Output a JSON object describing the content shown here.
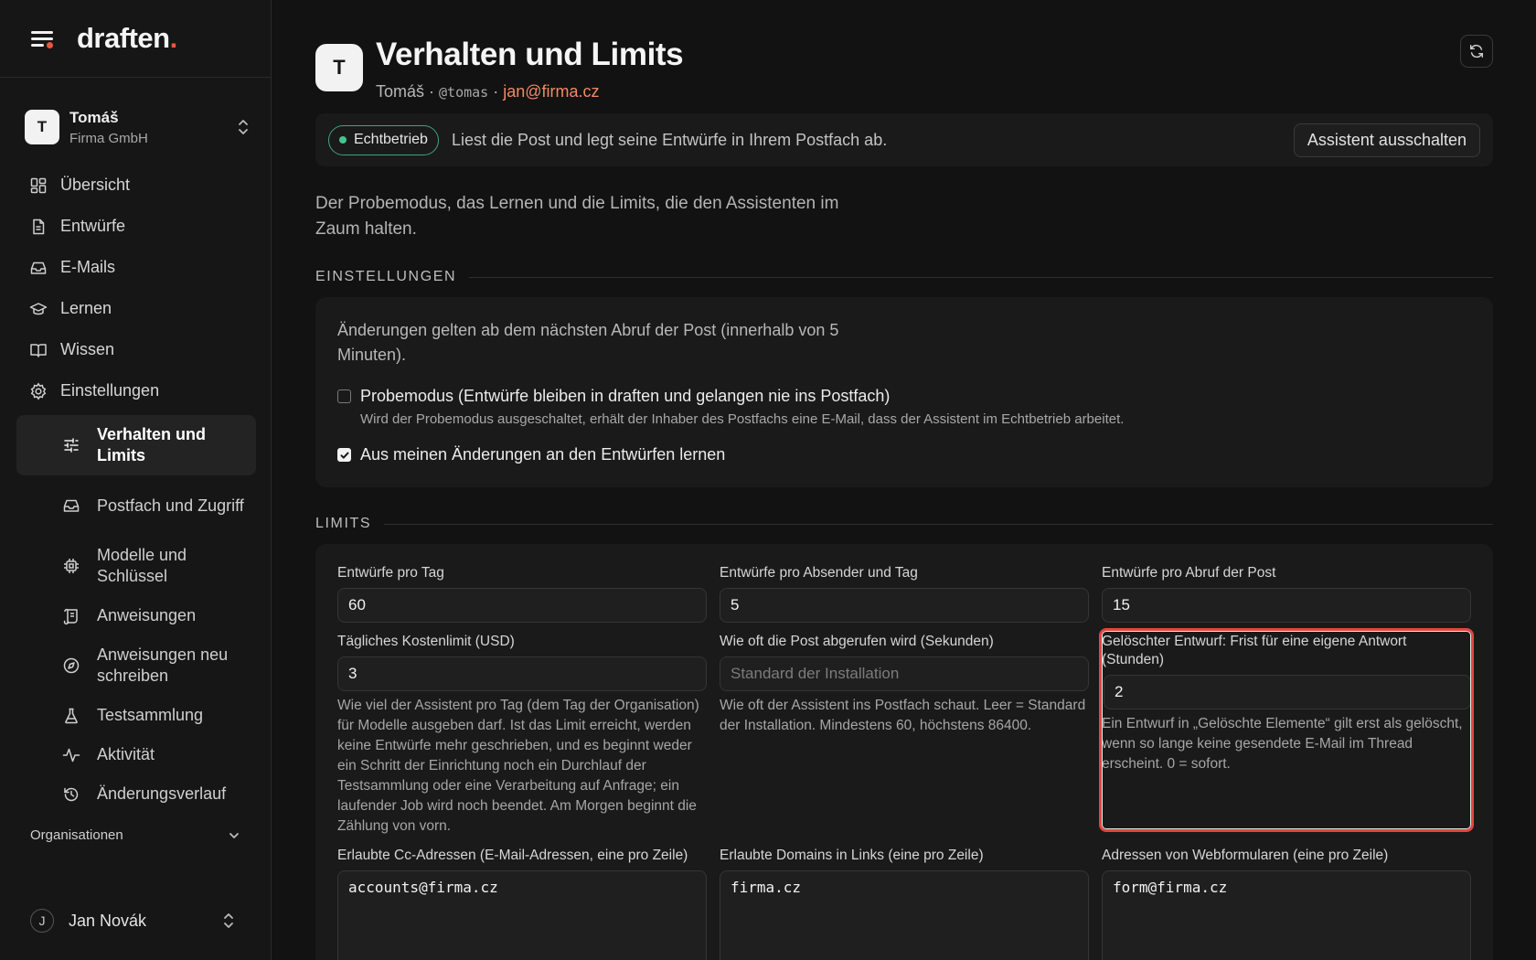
{
  "brand": {
    "name": "draften",
    "dot": "."
  },
  "account": {
    "initial": "T",
    "name": "Tomáš",
    "org": "Firma GmbH"
  },
  "nav": {
    "items": [
      {
        "label": "Übersicht"
      },
      {
        "label": "Entwürfe"
      },
      {
        "label": "E-Mails"
      },
      {
        "label": "Lernen"
      },
      {
        "label": "Wissen"
      },
      {
        "label": "Einstellungen"
      }
    ],
    "sub_items": [
      {
        "label": "Verhalten und Limits"
      },
      {
        "label": "Postfach und Zugriff"
      },
      {
        "label": "Modelle und Schlüssel"
      },
      {
        "label": "Anweisungen"
      },
      {
        "label": "Anweisungen neu schreiben"
      },
      {
        "label": "Testsammlung"
      },
      {
        "label": "Aktivität"
      },
      {
        "label": "Änderungsverlauf"
      }
    ],
    "organisations_label": "Organisationen"
  },
  "user": {
    "initial": "J",
    "name": "Jan Novák"
  },
  "page": {
    "avatar_initial": "T",
    "title": "Verhalten und Limits",
    "sub_name": "Tomáš",
    "sub_sep": " · ",
    "sub_handle": "@tomas",
    "sub_email": "jan@firma.cz",
    "intro": "Der Probemodus, das Lernen und die Limits, die den Assistenten im Zaum halten."
  },
  "status": {
    "badge": "Echtbetrieb",
    "text": "Liest die Post und legt seine Entwürfe in Ihrem Postfach ab.",
    "button": "Assistent ausschalten"
  },
  "settings": {
    "heading": "EINSTELLUNGEN",
    "note": "Änderungen gelten ab dem nächsten Abruf der Post (innerhalb von 5 Minuten).",
    "trial_label": "Probemodus (Entwürfe bleiben in draften und gelangen nie ins Postfach)",
    "trial_help": "Wird der Probemodus ausgeschaltet, erhält der Inhaber des Postfachs eine E-Mail, dass der Assistent im Echtbetrieb arbeitet.",
    "trial_checked": false,
    "learn_label": "Aus meinen Änderungen an den Entwürfen lernen",
    "learn_checked": true
  },
  "limits": {
    "heading": "LIMITS",
    "drafts_per_day": {
      "label": "Entwürfe pro Tag",
      "value": "60"
    },
    "drafts_per_sender": {
      "label": "Entwürfe pro Absender und Tag",
      "value": "5"
    },
    "drafts_per_fetch": {
      "label": "Entwürfe pro Abruf der Post",
      "value": "15"
    },
    "cost_limit": {
      "label": "Tägliches Kostenlimit (USD)",
      "value": "3",
      "help": "Wie viel der Assistent pro Tag (dem Tag der Organisation) für Modelle ausgeben darf. Ist das Limit erreicht, werden keine Entwürfe mehr geschrieben, und es beginnt weder ein Schritt der Einrichtung noch ein Durchlauf der Testsammlung oder eine Verarbeitung auf Anfrage; ein laufender Job wird noch beendet. Am Morgen beginnt die Zählung von vorn."
    },
    "poll_interval": {
      "label": "Wie oft die Post abgerufen wird (Sekunden)",
      "placeholder": "Standard der Installation",
      "help": "Wie oft der Assistent ins Postfach schaut. Leer = Standard der Installation. Mindestens 60, höchstens 86400."
    },
    "deleted_draft": {
      "label": "Gelöschter Entwurf: Frist für eine eigene Antwort (Stunden)",
      "value": "2",
      "help": "Ein Entwurf in „Gelöschte Elemente“ gilt erst als gelöscht, wenn so lange keine gesendete E-Mail im Thread erscheint. 0 = sofort."
    },
    "cc_addresses": {
      "label": "Erlaubte Cc-Adressen (E-Mail-Adressen, eine pro Zeile)",
      "value": "accounts@firma.cz"
    },
    "link_domains": {
      "label": "Erlaubte Domains in Links (eine pro Zeile)",
      "value": "firma.cz"
    },
    "webform_addresses": {
      "label": "Adressen von Webformularen (eine pro Zeile)",
      "value": "form@firma.cz"
    }
  },
  "icons": {
    "menu": "menu-icon",
    "refresh": "refresh-icon",
    "chevron": "chevron-updown-icon"
  },
  "colors": {
    "accent": "#e8563f",
    "email": "#f08a66",
    "live": "#46c48e",
    "highlight": "#e0473e"
  }
}
